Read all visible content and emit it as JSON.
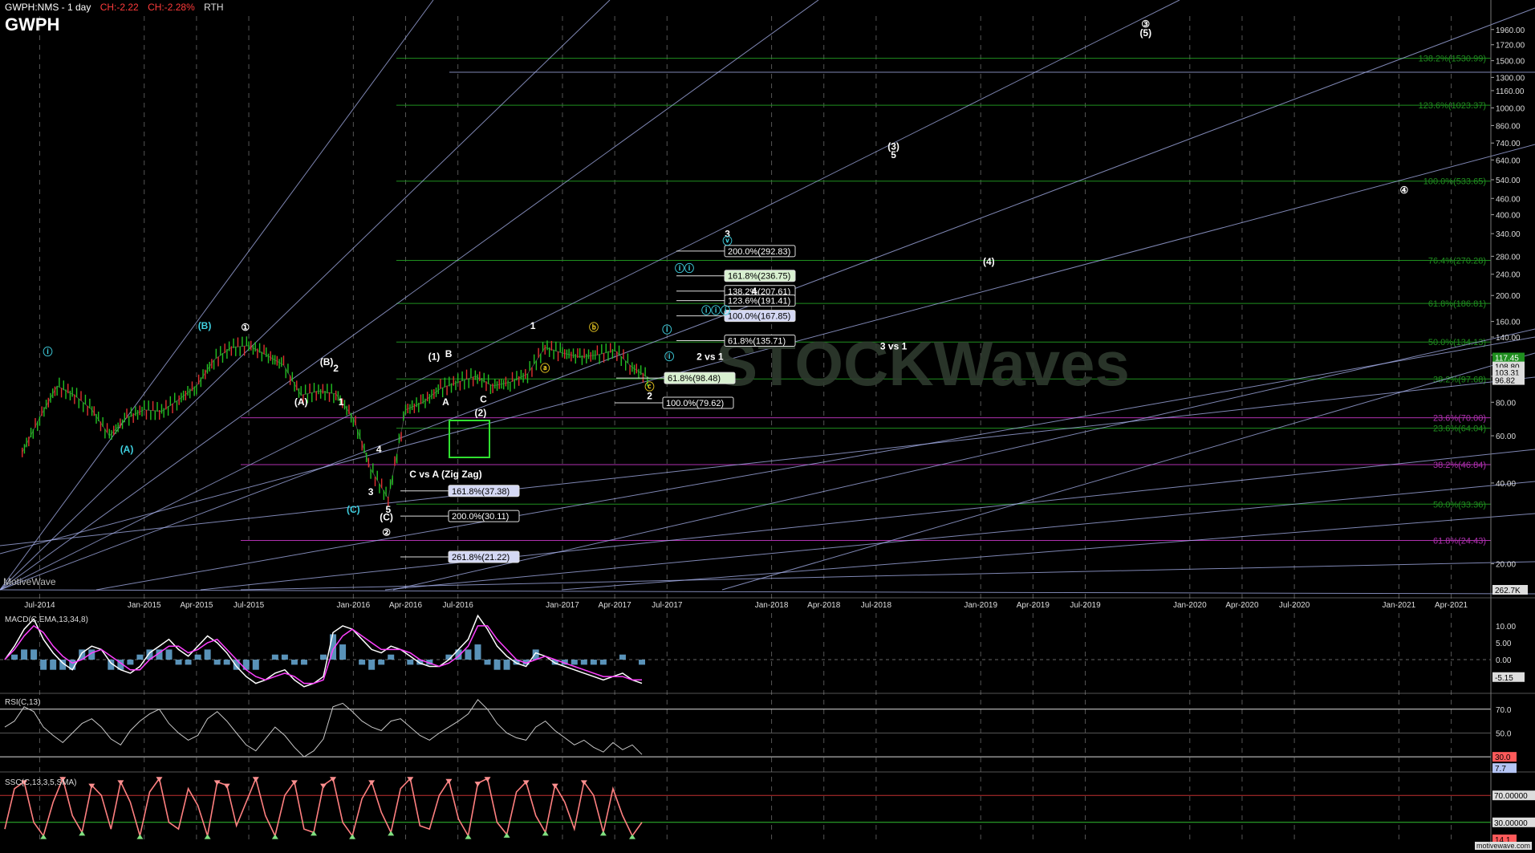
{
  "header": {
    "symbol": "GWPH:NMS - 1 day",
    "change_abs": "CH:-2.22",
    "change_pct": "CH:-2.28%",
    "session": "RTH",
    "ticker": "GWPH"
  },
  "brand": "MotiveWave",
  "footer_brand": "motivewave.com",
  "watermark": "STOCKWaves",
  "colors": {
    "background": "#000000",
    "price_up": "#22c022",
    "price_down": "#e03030",
    "gann_line": "#aab4f0",
    "fib_green": "#1f8f1f",
    "fib_magenta": "#b030b0",
    "wave_cyan": "#3fd0e0",
    "wave_yellow": "#e0c020",
    "macd_line": "#ffffff",
    "macd_signal": "#ff40ff",
    "macd_hist": "#6fb6e6",
    "stoch_k": "#ff8080",
    "grid": "#9a9a9a"
  },
  "chart_data": [
    {
      "type": "line",
      "panel": "price",
      "scale": "log",
      "x_axis_labels": [
        "Jul-2014",
        "Jan-2015",
        "Apr-2015",
        "Jul-2015",
        "Jan-2016",
        "Apr-2016",
        "Jul-2016",
        "Jan-2017",
        "Apr-2017",
        "Jul-2017",
        "Jan-2018",
        "Apr-2018",
        "Jul-2018",
        "Jan-2019",
        "Apr-2019",
        "Jul-2019",
        "Jan-2020",
        "Apr-2020",
        "Jul-2020",
        "Jan-2021",
        "Apr-2021"
      ],
      "y_tick_labels": [
        "1960.00",
        "1720.00",
        "1500.00",
        "1300.00",
        "1160.00",
        "1000.00",
        "860.00",
        "740.00",
        "640.00",
        "540.00",
        "460.00",
        "400.00",
        "340.00",
        "280.00",
        "240.00",
        "200.00",
        "160.00",
        "140.00",
        "120.00",
        "100.00",
        "80.00",
        "60.00",
        "40.00",
        "20.00"
      ],
      "last_price_tags": [
        "117.45",
        "108.80",
        "103.31",
        "96.82"
      ],
      "volume_tag": "262.7K",
      "ylim": [
        16,
        2200
      ],
      "series": [
        {
          "x": [
            "2014-06-01",
            "2014-07-01",
            "2014-08-01",
            "2014-09-01",
            "2014-10-01",
            "2014-11-01",
            "2014-12-01",
            "2015-01-01",
            "2015-02-01",
            "2015-03-01",
            "2015-04-01",
            "2015-05-01",
            "2015-06-01",
            "2015-07-01",
            "2015-08-01",
            "2015-09-01",
            "2015-10-01",
            "2015-11-01",
            "2015-12-01",
            "2016-01-01",
            "2016-02-01",
            "2016-03-01",
            "2016-04-01",
            "2016-05-01",
            "2016-06-01",
            "2016-07-01",
            "2016-08-01",
            "2016-09-01",
            "2016-10-01",
            "2016-11-01",
            "2016-12-01",
            "2017-01-01",
            "2017-02-01",
            "2017-03-01",
            "2017-04-01",
            "2017-05-01",
            "2017-06-01"
          ],
          "values": [
            52,
            70,
            92,
            85,
            75,
            60,
            70,
            75,
            74,
            82,
            92,
            115,
            128,
            130,
            120,
            110,
            85,
            88,
            86,
            70,
            45,
            35,
            75,
            80,
            90,
            95,
            100,
            92,
            95,
            102,
            128,
            122,
            118,
            120,
            125,
            108,
            98
          ]
        }
      ],
      "fib_levels": [
        {
          "label": "138.2%(1530.99)",
          "value": 1530.99,
          "color": "green"
        },
        {
          "label": "123.6%(1023.37)",
          "value": 1023.37,
          "color": "green"
        },
        {
          "label": "100.0%(533.65)",
          "value": 533.65,
          "color": "green"
        },
        {
          "label": "76.4%(270.28)",
          "value": 270.28,
          "color": "green"
        },
        {
          "label": "61.8%(186.81)",
          "value": 186.81,
          "color": "green"
        },
        {
          "label": "50.0%(134.13)",
          "value": 134.13,
          "color": "green"
        },
        {
          "label": "38.2%(97.68)",
          "value": 97.68,
          "color": "green"
        },
        {
          "label": "23.6%(70.00)",
          "value": 70.0,
          "color": "magenta"
        },
        {
          "label": "23.6%(64.04)",
          "value": 64.04,
          "color": "green"
        },
        {
          "label": "38.2%(46.84)",
          "value": 46.84,
          "color": "magenta"
        },
        {
          "label": "50.0%(33.36)",
          "value": 33.36,
          "color": "green"
        },
        {
          "label": "61.8%(24.43)",
          "value": 24.43,
          "color": "magenta"
        }
      ],
      "fib_boxes": [
        {
          "label": "200.0%(292.83)",
          "value": 292.83,
          "style": "dark"
        },
        {
          "label": "161.8%(236.75)",
          "value": 236.75,
          "style": "lightgreen"
        },
        {
          "label": "138.2%(207.61)",
          "value": 207.61,
          "style": "dark"
        },
        {
          "label": "123.6%(191.41)",
          "value": 191.41,
          "style": "dark"
        },
        {
          "label": "100.0%(167.85)",
          "value": 167.85,
          "style": "lightblue"
        },
        {
          "label": "61.8%(135.71)",
          "value": 135.71,
          "style": "dark"
        },
        {
          "label": "61.8%(98.48)",
          "value": 98.48,
          "style": "lightgreen"
        },
        {
          "label": "100.0%(79.62)",
          "value": 79.62,
          "style": "dark"
        },
        {
          "label": "161.8%(37.38)",
          "value": 37.38,
          "style": "lightblue"
        },
        {
          "label": "200.0%(30.11)",
          "value": 30.11,
          "style": "dark"
        },
        {
          "label": "261.8%(21.22)",
          "value": 21.22,
          "style": "lightblue"
        }
      ],
      "wave_labels": [
        {
          "text": "ⓘ",
          "color": "cyan",
          "date": "2014-07-15",
          "value": 120
        },
        {
          "text": "(A)",
          "color": "cyan",
          "date": "2014-12-01",
          "value": 52
        },
        {
          "text": "(B)",
          "color": "cyan",
          "date": "2015-04-15",
          "value": 150
        },
        {
          "text": "①",
          "color": "white",
          "date": "2015-06-25",
          "value": 148
        },
        {
          "text": "(B)",
          "color": "white",
          "date": "2015-11-15",
          "value": 110
        },
        {
          "text": "2",
          "color": "white",
          "date": "2015-12-01",
          "value": 104
        },
        {
          "text": "(A)",
          "color": "white",
          "date": "2015-10-01",
          "value": 78
        },
        {
          "text": "1",
          "color": "white",
          "date": "2015-12-10",
          "value": 78
        },
        {
          "text": "4",
          "color": "white",
          "date": "2016-02-15",
          "value": 52
        },
        {
          "text": "3",
          "color": "white",
          "date": "2016-02-01",
          "value": 36
        },
        {
          "text": "(C)",
          "color": "cyan",
          "date": "2016-01-01",
          "value": 31
        },
        {
          "text": "5",
          "color": "white",
          "date": "2016-03-01",
          "value": 31
        },
        {
          "text": "(C)",
          "color": "white",
          "date": "2016-02-28",
          "value": 29
        },
        {
          "text": "②",
          "color": "white",
          "date": "2016-02-28",
          "value": 25.5
        },
        {
          "text": "(1)",
          "color": "white",
          "date": "2016-05-20",
          "value": 115
        },
        {
          "text": "B",
          "color": "white",
          "date": "2016-06-15",
          "value": 118
        },
        {
          "text": "A",
          "color": "white",
          "date": "2016-06-10",
          "value": 78
        },
        {
          "text": "C",
          "color": "white",
          "date": "2016-08-15",
          "value": 80
        },
        {
          "text": "(2)",
          "color": "white",
          "date": "2016-08-10",
          "value": 71
        },
        {
          "text": "1",
          "color": "white",
          "date": "2016-11-10",
          "value": 150
        },
        {
          "text": "ⓐ",
          "color": "yellow",
          "date": "2016-12-01",
          "value": 104
        },
        {
          "text": "ⓑ",
          "color": "yellow",
          "date": "2017-02-25",
          "value": 148
        },
        {
          "text": "ⓒ",
          "color": "yellow",
          "date": "2017-06-01",
          "value": 89
        },
        {
          "text": "2",
          "color": "white",
          "date": "2017-06-01",
          "value": 82
        },
        {
          "text": "ⓘ",
          "color": "cyan",
          "date": "2017-07-01",
          "value": 145
        },
        {
          "text": "ⓘ",
          "color": "cyan",
          "date": "2017-07-05",
          "value": 115
        },
        {
          "text": "2 vs 1",
          "color": "white",
          "date": "2017-09-15",
          "value": 115
        },
        {
          "text": "ⓘⓘ",
          "color": "cyan",
          "date": "2017-08-01",
          "value": 245
        },
        {
          "text": "ⓘⓘⓘ",
          "color": "cyan",
          "date": "2017-09-25",
          "value": 171
        },
        {
          "text": "3",
          "color": "white",
          "date": "2017-10-15",
          "value": 330
        },
        {
          "text": "ⓥ",
          "color": "cyan",
          "date": "2017-10-15",
          "value": 310
        },
        {
          "text": "4",
          "color": "white",
          "date": "2017-12-01",
          "value": 202
        },
        {
          "text": "3 vs 1",
          "color": "white",
          "date": "2018-08-01",
          "value": 126
        },
        {
          "text": "(3)",
          "color": "white",
          "date": "2018-08-01",
          "value": 700
        },
        {
          "text": "5",
          "color": "white",
          "date": "2018-08-01",
          "value": 650
        },
        {
          "text": "(4)",
          "color": "white",
          "date": "2019-01-15",
          "value": 260
        },
        {
          "text": "③",
          "color": "white",
          "date": "2019-10-15",
          "value": 2000
        },
        {
          "text": "(5)",
          "color": "white",
          "date": "2019-10-15",
          "value": 1850
        },
        {
          "text": "④",
          "color": "white",
          "date": "2021-01-10",
          "value": 480
        },
        {
          "text": "C vs A (Zig Zag)",
          "color": "white",
          "date": "2016-06-10",
          "value": 42
        }
      ]
    },
    {
      "type": "line",
      "panel": "macd",
      "title": "MACD(C,EMA,13,34,8)",
      "y_tick_labels": [
        "10.00",
        "5.00",
        "0.00"
      ],
      "last_value_tag": "-5.15",
      "ylim": [
        -9,
        14
      ],
      "series": [
        {
          "name": "macd",
          "values": [
            0,
            4,
            9,
            12,
            6,
            2,
            -1,
            -3,
            2,
            4,
            3,
            -1,
            -3,
            -4,
            -2,
            2,
            4,
            6,
            3,
            1,
            4,
            7,
            5,
            2,
            -2,
            -5,
            -7,
            -6,
            -4,
            -3,
            -6,
            -8,
            -7,
            -5,
            8,
            10,
            9,
            6,
            3,
            2,
            4,
            3,
            1,
            -1,
            -2,
            -2,
            0,
            3,
            6,
            13,
            9,
            4,
            1,
            -1,
            -2,
            2,
            1,
            -1,
            -2,
            -3,
            -4,
            -5,
            -6,
            -5,
            -4,
            -6,
            -7
          ]
        },
        {
          "name": "signal",
          "values": [
            0,
            3,
            7,
            10,
            8,
            4,
            1,
            -1,
            0,
            2,
            3,
            1,
            -1,
            -3,
            -3,
            0,
            2,
            4,
            4,
            2,
            3,
            5,
            6,
            3,
            0,
            -3,
            -5,
            -6,
            -5,
            -4,
            -5,
            -7,
            -7,
            -6,
            3,
            7,
            9,
            7,
            5,
            3,
            3,
            3,
            2,
            0,
            -1,
            -2,
            -1,
            1,
            4,
            10,
            10,
            6,
            3,
            0,
            -1,
            0,
            1,
            0,
            -1,
            -2,
            -3,
            -4,
            -5,
            -5,
            -5,
            -6,
            -6
          ]
        }
      ]
    },
    {
      "type": "line",
      "panel": "rsi",
      "title": "RSI(C,13)",
      "y_tick_labels": [
        "70.0",
        "50.0"
      ],
      "last_value_tags": [
        "30.0",
        "7.7"
      ],
      "ylim": [
        20,
        82
      ],
      "series": [
        {
          "name": "rsi",
          "values": [
            55,
            60,
            72,
            68,
            55,
            48,
            42,
            50,
            58,
            62,
            55,
            45,
            40,
            52,
            60,
            66,
            70,
            58,
            50,
            44,
            48,
            62,
            68,
            60,
            50,
            40,
            35,
            45,
            55,
            48,
            38,
            30,
            35,
            45,
            72,
            75,
            68,
            60,
            55,
            52,
            60,
            62,
            55,
            48,
            44,
            50,
            55,
            60,
            66,
            78,
            70,
            58,
            50,
            46,
            44,
            55,
            60,
            52,
            46,
            40,
            44,
            38,
            34,
            42,
            36,
            40,
            32
          ]
        }
      ]
    },
    {
      "type": "line",
      "panel": "stochastic",
      "title": "SSC(C,13,3,5,SMA)",
      "y_tick_labels": [
        "70.00000",
        "30.00000"
      ],
      "last_value_tag": "14.1",
      "ylim": [
        0,
        100
      ],
      "series": [
        {
          "name": "k",
          "values": [
            20,
            80,
            90,
            30,
            10,
            60,
            95,
            40,
            15,
            85,
            70,
            20,
            90,
            60,
            10,
            75,
            95,
            30,
            20,
            80,
            55,
            10,
            90,
            85,
            25,
            60,
            95,
            40,
            10,
            70,
            90,
            20,
            15,
            85,
            95,
            30,
            10,
            65,
            90,
            45,
            15,
            80,
            95,
            25,
            20,
            70,
            92,
            35,
            10,
            88,
            95,
            30,
            12,
            75,
            90,
            40,
            15,
            85,
            60,
            20,
            90,
            70,
            15,
            80,
            40,
            10,
            30
          ]
        }
      ]
    }
  ]
}
